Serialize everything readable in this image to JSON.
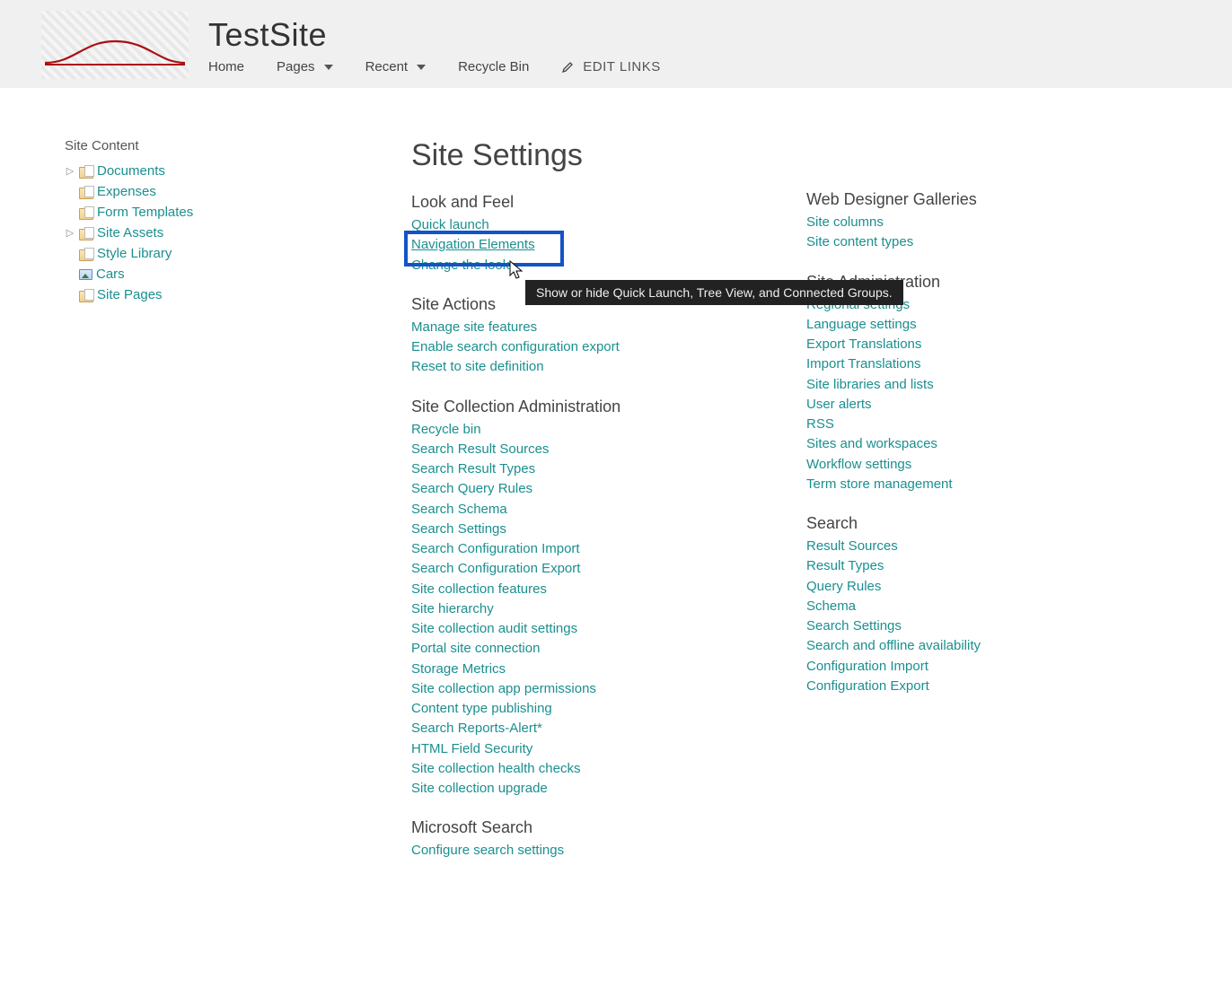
{
  "header": {
    "site_title": "TestSite",
    "nav": {
      "home": "Home",
      "pages": "Pages",
      "recent": "Recent",
      "recycle_bin": "Recycle Bin",
      "edit_links": "EDIT LINKS"
    }
  },
  "sidebar": {
    "heading": "Site Content",
    "items": [
      {
        "label": "Documents",
        "expandable": true,
        "icon": "doclib"
      },
      {
        "label": "Expenses",
        "expandable": false,
        "icon": "doclib"
      },
      {
        "label": "Form Templates",
        "expandable": false,
        "icon": "doclib"
      },
      {
        "label": "Site Assets",
        "expandable": true,
        "icon": "doclib"
      },
      {
        "label": "Style Library",
        "expandable": false,
        "icon": "doclib"
      },
      {
        "label": "Cars",
        "expandable": false,
        "icon": "piclib"
      },
      {
        "label": "Site Pages",
        "expandable": false,
        "icon": "doclib"
      }
    ]
  },
  "main": {
    "page_title": "Site Settings",
    "tooltip": "Show or hide Quick Launch, Tree View, and Connected Groups.",
    "left_sections": [
      {
        "heading": "Look and Feel",
        "links": [
          "Quick launch",
          "Navigation Elements",
          "Change the look"
        ]
      },
      {
        "heading": "Site Actions",
        "links": [
          "Manage site features",
          "Enable search configuration export",
          "Reset to site definition"
        ]
      },
      {
        "heading": "Site Collection Administration",
        "links": [
          "Recycle bin",
          "Search Result Sources",
          "Search Result Types",
          "Search Query Rules",
          "Search Schema",
          "Search Settings",
          "Search Configuration Import",
          "Search Configuration Export",
          "Site collection features",
          "Site hierarchy",
          "Site collection audit settings",
          "Portal site connection",
          "Storage Metrics",
          "Site collection app permissions",
          "Content type publishing",
          "Search Reports-Alert*",
          "HTML Field Security",
          "Site collection health checks",
          "Site collection upgrade"
        ]
      },
      {
        "heading": "Microsoft Search",
        "links": [
          "Configure search settings"
        ]
      }
    ],
    "right_sections": [
      {
        "heading": "Web Designer Galleries",
        "links": [
          "Site columns",
          "Site content types"
        ]
      },
      {
        "heading": "Site Administration",
        "links": [
          "Regional settings",
          "Language settings",
          "Export Translations",
          "Import Translations",
          "Site libraries and lists",
          "User alerts",
          "RSS",
          "Sites and workspaces",
          "Workflow settings",
          "Term store management"
        ]
      },
      {
        "heading": "Search",
        "links": [
          "Result Sources",
          "Result Types",
          "Query Rules",
          "Schema",
          "Search Settings",
          "Search and offline availability",
          "Configuration Import",
          "Configuration Export"
        ]
      }
    ]
  }
}
